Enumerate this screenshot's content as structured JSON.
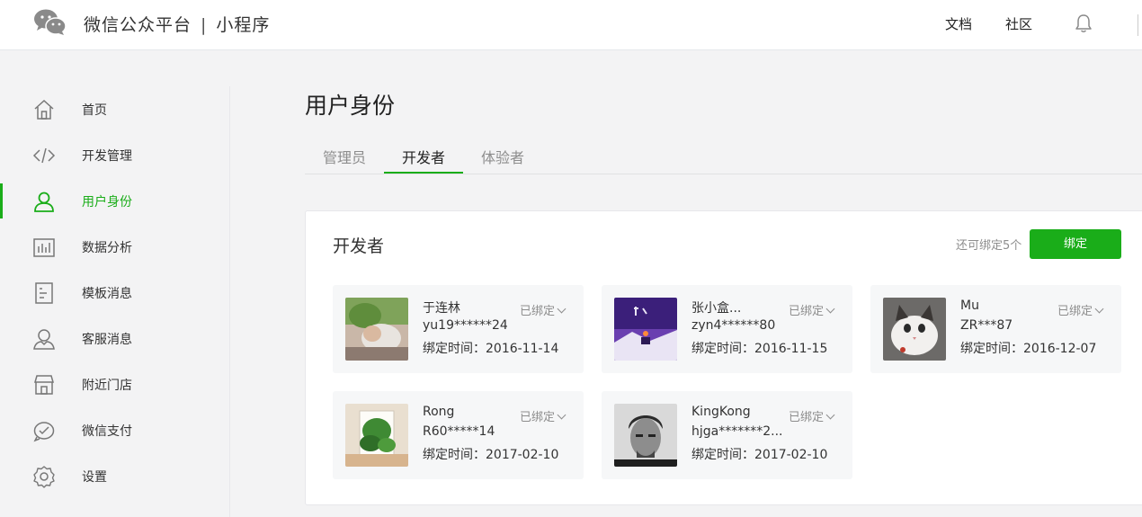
{
  "header": {
    "brand": "微信公众平台",
    "separator": "|",
    "product": "小程序",
    "links": [
      "文档",
      "社区"
    ]
  },
  "sidebar": {
    "items": [
      {
        "label": "首页",
        "icon": "home-icon"
      },
      {
        "label": "开发管理",
        "icon": "code-icon"
      },
      {
        "label": "用户身份",
        "icon": "user-icon",
        "active": true
      },
      {
        "label": "数据分析",
        "icon": "bar-chart-icon"
      },
      {
        "label": "模板消息",
        "icon": "template-icon"
      },
      {
        "label": "客服消息",
        "icon": "customer-service-icon"
      },
      {
        "label": "附近门店",
        "icon": "store-icon"
      },
      {
        "label": "微信支付",
        "icon": "payment-icon"
      },
      {
        "label": "设置",
        "icon": "settings-icon"
      }
    ]
  },
  "main": {
    "title": "用户身份",
    "tabs": [
      {
        "label": "管理员"
      },
      {
        "label": "开发者",
        "active": true
      },
      {
        "label": "体验者"
      }
    ]
  },
  "card": {
    "title": "开发者",
    "remain_text": "还可绑定5个",
    "bind_label": "绑定",
    "users": [
      {
        "name": "于连林",
        "id": "yu19******24",
        "time": "绑定时间：2016-11-14",
        "status": "已绑定"
      },
      {
        "name": "张小盒...",
        "id": "zyn4******80",
        "time": "绑定时间：2016-11-15",
        "status": "已绑定"
      },
      {
        "name": "Mu",
        "id": "ZR***87",
        "time": "绑定时间：2016-12-07",
        "status": "已绑定"
      },
      {
        "name": "Rong",
        "id": "R60*****14",
        "time": "绑定时间：2017-02-10",
        "status": "已绑定"
      },
      {
        "name": "KingKong",
        "id": "hjga*******2...",
        "time": "绑定时间：2017-02-10",
        "status": "已绑定"
      }
    ]
  },
  "colors": {
    "accent": "#1aad19",
    "muted": "#8d8d8d"
  }
}
